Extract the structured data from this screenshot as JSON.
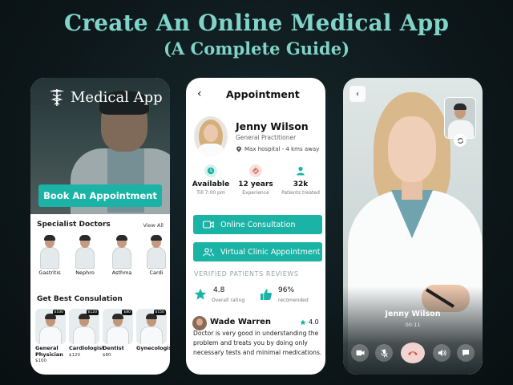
{
  "headline": {
    "line1": "Create An Online Medical App",
    "line2": "(A Complete Guide)"
  },
  "colors": {
    "accent": "#1ab3a6",
    "headline": "#7fd3c8",
    "background": "#0c1518"
  },
  "home_screen": {
    "brand": "Medical App",
    "book_button": "Book An Appointment",
    "specialists_title": "Specialist Doctors",
    "view_all": "View All",
    "specialists": [
      {
        "label": "Gastritis"
      },
      {
        "label": "Nephro"
      },
      {
        "label": "Asthma"
      },
      {
        "label": "Cardi"
      }
    ],
    "consult_title": "Get Best Consulation",
    "consults": [
      {
        "name": "General Physician",
        "price": "$100",
        "badge": "$100"
      },
      {
        "name": "Cardiologist",
        "price": "$120",
        "badge": "$120"
      },
      {
        "name": "Dentist",
        "price": "$80",
        "badge": "$80"
      },
      {
        "name": "Gynecologist",
        "price": "",
        "badge": "$150"
      }
    ]
  },
  "appointment_screen": {
    "title": "Appointment",
    "doctor": {
      "name": "Jenny Wilson",
      "role": "General Practitioner",
      "location": "Max hospital - 4 kms away"
    },
    "stats": [
      {
        "value": "Available",
        "sub": "Till 7:00 pm",
        "icon": "clock-icon",
        "color": "#1ab3a6"
      },
      {
        "value": "12 years",
        "sub": "Experience",
        "icon": "badge-icon",
        "color": "#e0776a"
      },
      {
        "value": "32k",
        "sub": "Patients treated",
        "icon": "user-icon",
        "color": "#1ab3a6"
      }
    ],
    "actions": [
      {
        "label": "Online Consultation",
        "icon": "video-icon"
      },
      {
        "label": "Virtual Clinic Appointment",
        "icon": "users-icon"
      }
    ],
    "reviews_title": "VERIFIED PATIENTS REVIEWS",
    "overall_rating": "4.8",
    "overall_rating_label": "Overall rating",
    "recommended": "96%",
    "recommended_label": "recomended",
    "review": {
      "author": "Wade Warren",
      "score": "4.0",
      "text": "Doctor is very good in understanding the problem and treats you by doing only necessary tests and minimal medications."
    }
  },
  "video_call_screen": {
    "caller": "Jenny Wilson",
    "timer": "00:11",
    "controls": [
      "camera-icon",
      "mic-off-icon",
      "end-call-icon",
      "speaker-icon",
      "chat-icon"
    ]
  }
}
